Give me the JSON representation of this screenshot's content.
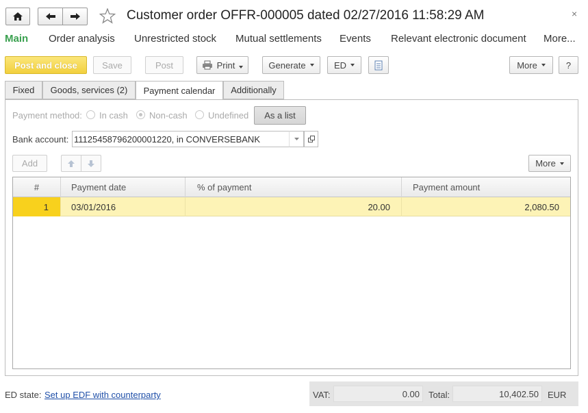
{
  "window": {
    "title": "Customer order OFFR-000005 dated 02/27/2016 11:58:29 AM",
    "close_glyph": "×"
  },
  "nav": {
    "main": "Main",
    "order_analysis": "Order analysis",
    "unrestricted_stock": "Unrestricted stock",
    "mutual_settlements": "Mutual settlements",
    "events": "Events",
    "relevant_ed": "Relevant electronic document",
    "more": "More..."
  },
  "toolbar": {
    "post_close": "Post and close",
    "save": "Save",
    "post": "Post",
    "print": "Print",
    "generate": "Generate",
    "ed": "ED",
    "more": "More",
    "help": "?"
  },
  "tabs": [
    "Fixed",
    "Goods, services (2)",
    "Payment calendar",
    "Additionally"
  ],
  "payment": {
    "method_label": "Payment method:",
    "options": [
      "In cash",
      "Non-cash",
      "Undefined"
    ],
    "selected": "Non-cash",
    "as_list": "As a list",
    "bank_label": "Bank account:",
    "bank_value": "11125458796200001220, in CONVERSEBANK"
  },
  "grid_toolbar": {
    "add": "Add",
    "more": "More"
  },
  "table": {
    "columns": [
      "#",
      "Payment date",
      "% of payment",
      "Payment amount"
    ],
    "rows": [
      {
        "num": "1",
        "date": "03/01/2016",
        "percent": "20.00",
        "amount": "2,080.50"
      }
    ]
  },
  "footer": {
    "ed_state_label": "ED state:",
    "ed_state_link": "Set up EDF with counterparty",
    "vat_label": "VAT:",
    "vat_value": "0.00",
    "total_label": "Total:",
    "total_value": "10,402.50",
    "currency": "EUR"
  },
  "colors": {
    "accent_green": "#3aa04f",
    "primary_button": "#f5d84a",
    "row_highlight": "#fdf3b6",
    "link_blue": "#1f4fa8"
  }
}
